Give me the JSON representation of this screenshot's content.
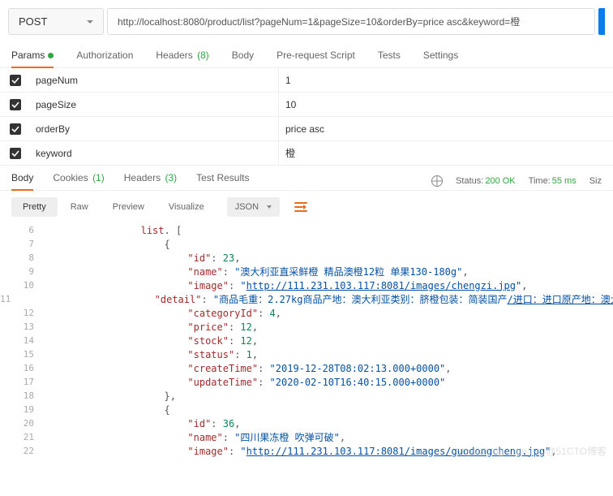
{
  "request": {
    "method": "POST",
    "url": "http://localhost:8080/product/list?pageNum=1&pageSize=10&orderBy=price asc&keyword=橙"
  },
  "reqTabs": {
    "params": "Params",
    "auth": "Authorization",
    "headers": "Headers",
    "headersCount": "(8)",
    "body": "Body",
    "prereq": "Pre-request Script",
    "tests": "Tests",
    "settings": "Settings"
  },
  "params": [
    {
      "key": "pageNum",
      "value": "1"
    },
    {
      "key": "pageSize",
      "value": "10"
    },
    {
      "key": "orderBy",
      "value": "price asc"
    },
    {
      "key": "keyword",
      "value": "橙"
    }
  ],
  "respTabs": {
    "body": "Body",
    "cookies": "Cookies",
    "cookiesCount": "(1)",
    "headers": "Headers",
    "headersCount": "(3)",
    "testResults": "Test Results"
  },
  "respMeta": {
    "statusLabel": "Status:",
    "statusValue": "200 OK",
    "timeLabel": "Time:",
    "timeValue": "55 ms",
    "sizeLabel": "Siz"
  },
  "viewBar": {
    "pretty": "Pretty",
    "raw": "Raw",
    "preview": "Preview",
    "visualize": "Visualize",
    "format": "JSON"
  },
  "codeLines": [
    {
      "n": "6",
      "indent": 16,
      "tokens": [
        {
          "t": "key",
          "v": "list"
        },
        {
          "t": "punc",
          "v": ". ["
        }
      ]
    },
    {
      "n": "7",
      "indent": 20,
      "tokens": [
        {
          "t": "punc",
          "v": "{"
        }
      ]
    },
    {
      "n": "8",
      "indent": 24,
      "tokens": [
        {
          "t": "key",
          "v": "\"id\""
        },
        {
          "t": "punc",
          "v": ": "
        },
        {
          "t": "num",
          "v": "23"
        },
        {
          "t": "punc",
          "v": ","
        }
      ]
    },
    {
      "n": "9",
      "indent": 24,
      "tokens": [
        {
          "t": "key",
          "v": "\"name\""
        },
        {
          "t": "punc",
          "v": ": "
        },
        {
          "t": "str",
          "v": "\"澳大利亚直采鲜橙 精品澳橙12粒 单果130-180g\""
        },
        {
          "t": "punc",
          "v": ","
        }
      ]
    },
    {
      "n": "10",
      "indent": 24,
      "tokens": [
        {
          "t": "key",
          "v": "\"image\""
        },
        {
          "t": "punc",
          "v": ": "
        },
        {
          "t": "str",
          "v": "\""
        },
        {
          "t": "link",
          "v": "http://111.231.103.117:8081/images/chengzi.jpg"
        },
        {
          "t": "str",
          "v": "\""
        },
        {
          "t": "punc",
          "v": ","
        }
      ]
    },
    {
      "n": "11",
      "indent": 24,
      "tokens": [
        {
          "t": "key",
          "v": "\"detail\""
        },
        {
          "t": "punc",
          "v": ": "
        },
        {
          "t": "str",
          "v": "\"商品毛重：2.27kg商品产地：澳大利亚类别：脐橙包装：简装国产"
        },
        {
          "t": "link",
          "v": "/进口：进口原产地：澳大"
        }
      ]
    },
    {
      "n": "12",
      "indent": 24,
      "tokens": [
        {
          "t": "key",
          "v": "\"categoryId\""
        },
        {
          "t": "punc",
          "v": ": "
        },
        {
          "t": "num",
          "v": "4"
        },
        {
          "t": "punc",
          "v": ","
        }
      ]
    },
    {
      "n": "13",
      "indent": 24,
      "tokens": [
        {
          "t": "key",
          "v": "\"price\""
        },
        {
          "t": "punc",
          "v": ": "
        },
        {
          "t": "num",
          "v": "12"
        },
        {
          "t": "punc",
          "v": ","
        }
      ]
    },
    {
      "n": "14",
      "indent": 24,
      "tokens": [
        {
          "t": "key",
          "v": "\"stock\""
        },
        {
          "t": "punc",
          "v": ": "
        },
        {
          "t": "num",
          "v": "12"
        },
        {
          "t": "punc",
          "v": ","
        }
      ]
    },
    {
      "n": "15",
      "indent": 24,
      "tokens": [
        {
          "t": "key",
          "v": "\"status\""
        },
        {
          "t": "punc",
          "v": ": "
        },
        {
          "t": "num",
          "v": "1"
        },
        {
          "t": "punc",
          "v": ","
        }
      ]
    },
    {
      "n": "16",
      "indent": 24,
      "tokens": [
        {
          "t": "key",
          "v": "\"createTime\""
        },
        {
          "t": "punc",
          "v": ": "
        },
        {
          "t": "str",
          "v": "\"2019-12-28T08:02:13.000+0000\""
        },
        {
          "t": "punc",
          "v": ","
        }
      ]
    },
    {
      "n": "17",
      "indent": 24,
      "tokens": [
        {
          "t": "key",
          "v": "\"updateTime\""
        },
        {
          "t": "punc",
          "v": ": "
        },
        {
          "t": "str",
          "v": "\"2020-02-10T16:40:15.000+0000\""
        }
      ]
    },
    {
      "n": "18",
      "indent": 20,
      "tokens": [
        {
          "t": "punc",
          "v": "},"
        }
      ]
    },
    {
      "n": "19",
      "indent": 20,
      "tokens": [
        {
          "t": "punc",
          "v": "{"
        }
      ]
    },
    {
      "n": "20",
      "indent": 24,
      "tokens": [
        {
          "t": "key",
          "v": "\"id\""
        },
        {
          "t": "punc",
          "v": ": "
        },
        {
          "t": "num",
          "v": "36"
        },
        {
          "t": "punc",
          "v": ","
        }
      ]
    },
    {
      "n": "21",
      "indent": 24,
      "tokens": [
        {
          "t": "key",
          "v": "\"name\""
        },
        {
          "t": "punc",
          "v": ": "
        },
        {
          "t": "str",
          "v": "\"四川果冻橙 吹弹可破\""
        },
        {
          "t": "punc",
          "v": ","
        }
      ]
    },
    {
      "n": "22",
      "indent": 24,
      "tokens": [
        {
          "t": "key",
          "v": "\"image\""
        },
        {
          "t": "punc",
          "v": ": "
        },
        {
          "t": "str",
          "v": "\""
        },
        {
          "t": "link",
          "v": "http://111.231.103.117:8081/images/guodongcheng.jpg"
        },
        {
          "t": "str",
          "v": "\""
        },
        {
          "t": "punc",
          "v": ","
        }
      ]
    }
  ],
  "watermark": "https://blog.csdn.net/@51CTO博客"
}
